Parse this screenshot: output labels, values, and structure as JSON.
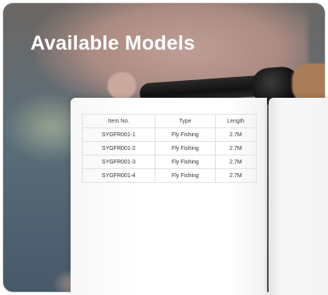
{
  "title": "Available Models",
  "table": {
    "headers": [
      "Item No.",
      "Type",
      "Length"
    ],
    "rows": [
      [
        "SYGFR001-1",
        "Fly Fishing",
        "2.7M"
      ],
      [
        "SYGFR001-2",
        "Fly Fishing",
        "2.7M"
      ],
      [
        "SYGFR001-3",
        "Fly Fishing",
        "2.7M"
      ],
      [
        "SYGFR001-4",
        "Fly Fishing",
        "2.7M"
      ]
    ]
  }
}
